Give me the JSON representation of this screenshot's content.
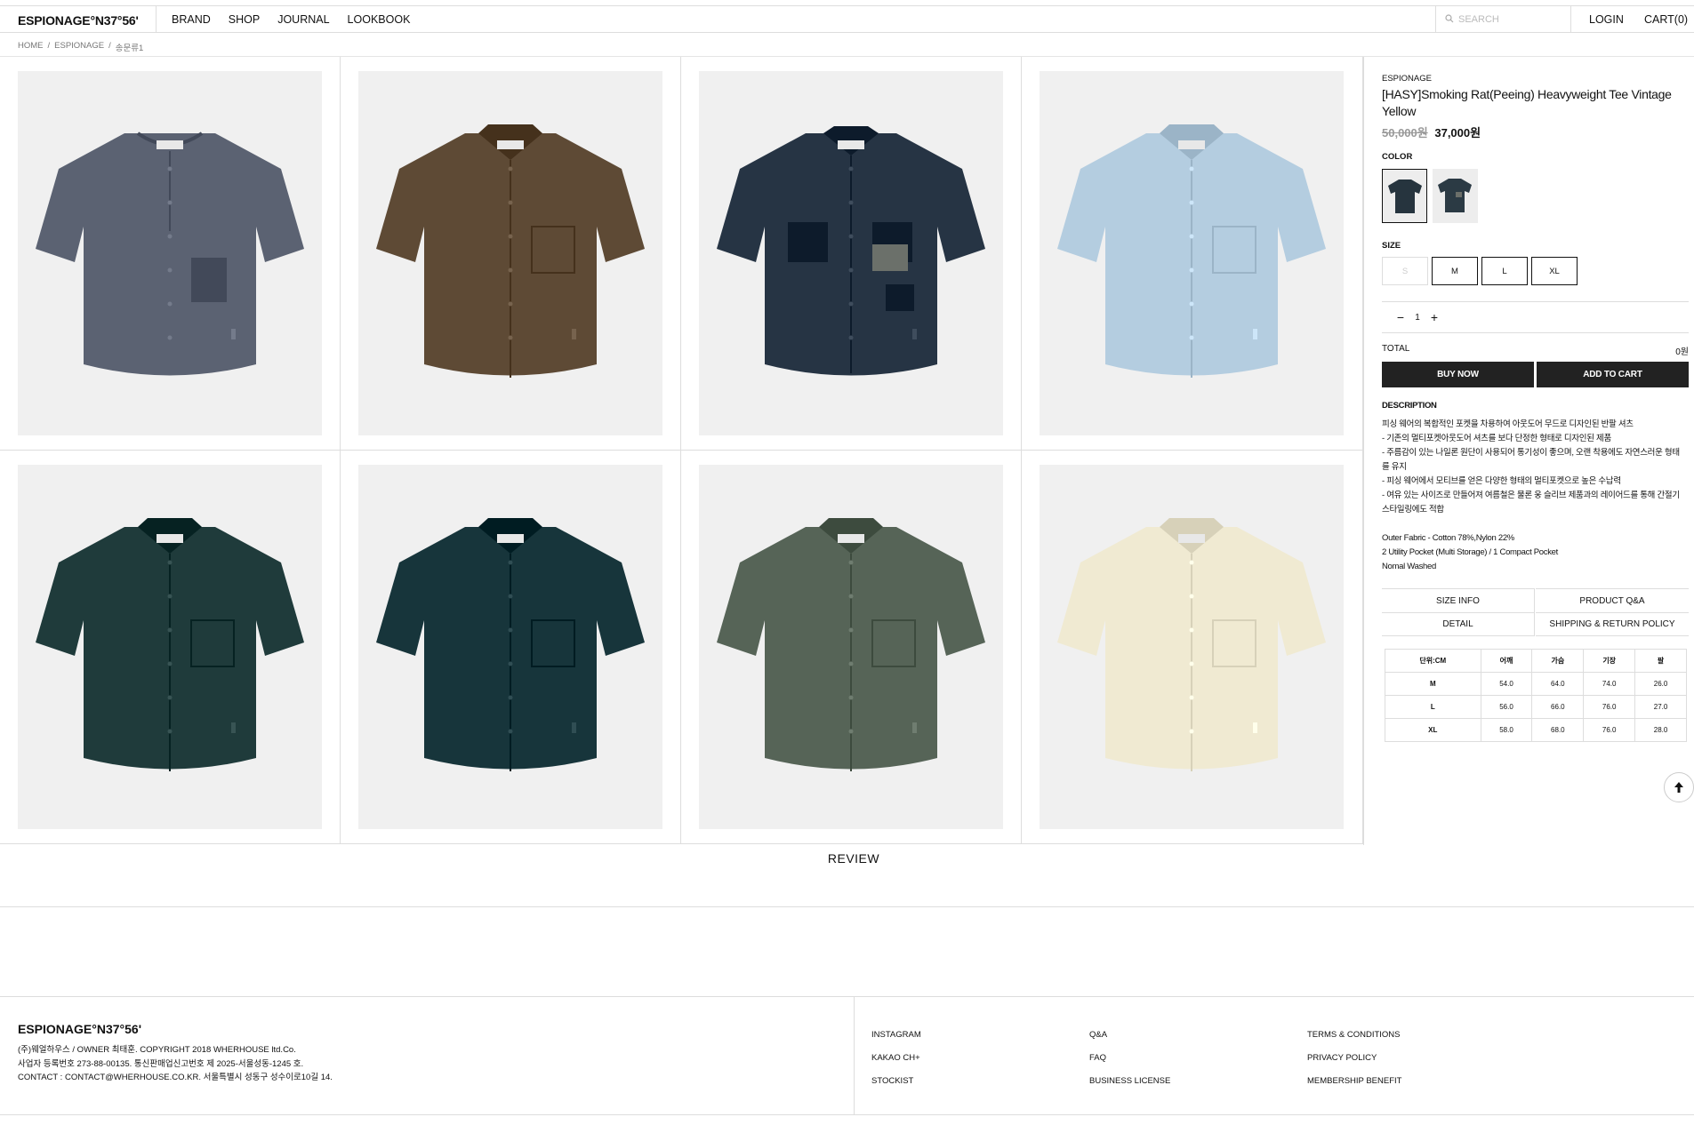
{
  "header": {
    "logo": "ESPIONAGE°N37°56'",
    "nav": [
      "BRAND",
      "SHOP",
      "JOURNAL",
      "LOOKBOOK"
    ],
    "search_placeholder": "SEARCH",
    "login": "LOGIN",
    "cart": "CART(0)"
  },
  "breadcrumb": [
    "HOME",
    "/",
    "ESPIONAGE",
    "/",
    "송문류1"
  ],
  "gallery": [
    {
      "color": "#5b6272",
      "style": "henley"
    },
    {
      "color": "#5e4a35",
      "style": "shirt"
    },
    {
      "color": "#263444",
      "style": "utility"
    },
    {
      "color": "#b4cde0",
      "style": "open"
    },
    {
      "color": "#1f3b3b",
      "style": "open"
    },
    {
      "color": "#17353b",
      "style": "shirt"
    },
    {
      "color": "#566457",
      "style": "open"
    },
    {
      "color": "#f0ead2",
      "style": "shirt"
    }
  ],
  "product": {
    "brand": "ESPIONAGE",
    "title": "[HASY]Smoking Rat(Peeing) Heavyweight Tee Vintage Yellow",
    "price_original": "50,000원",
    "price_sale": "37,000원",
    "color_label": "COLOR",
    "swatches": [
      "#26343e",
      "#2b3a44"
    ],
    "size_label": "SIZE",
    "sizes": [
      "S",
      "M",
      "L",
      "XL"
    ],
    "quantity": "1",
    "total_label": "TOTAL",
    "total_value": "0원",
    "buy_now": "BUY NOW",
    "add_to_cart": "ADD TO CART",
    "description_label": "DESCRIPTION",
    "description": [
      "피싱 웨어의 복합적인 포켓을 차용하여 아웃도어 무드로 디자인된 반팔 셔츠",
      "- 기존의 멀티포켓아웃도어 셔츠를 보다 단정한 형태로 디자인된 제품",
      "- 주름감이 있는 나일론 원단이 사용되어 통기성이 좋으며, 오랜 착용에도 자연스러운 형태",
      "를 유지",
      "- 피싱 웨어에서 모티브를 얻은 다양한 형태의 멀티포켓으로 높은 수납력",
      "- 여유 있는 사이즈로 만들어져 여름철은 물론 웅 슬리브 제품과의 레이어드를 통해 간절기",
      "스타일링에도 적합"
    ],
    "specs": [
      "Outer Fabric - Cotton 78%,Nylon 22%",
      "2 Utility Pocket (Multi Storage) / 1 Compact Pocket",
      "Nomal Washed"
    ],
    "tabs": [
      "SIZE INFO",
      "PRODUCT Q&A",
      "DETAIL",
      "SHIPPING & RETURN POLICY"
    ],
    "size_table": {
      "headers": [
        "단위:CM",
        "어깨",
        "가슴",
        "기장",
        "팔"
      ],
      "rows": [
        [
          "M",
          "54.0",
          "64.0",
          "74.0",
          "26.0"
        ],
        [
          "L",
          "56.0",
          "66.0",
          "76.0",
          "27.0"
        ],
        [
          "XL",
          "58.0",
          "68.0",
          "76.0",
          "28.0"
        ]
      ]
    }
  },
  "review": "REVIEW",
  "footer": {
    "logo": "ESPIONAGE°N37°56'",
    "info": [
      "(주)웨얼하우스 / OWNER 최태훈. COPYRIGHT 2018 WHERHOUSE ltd.Co.",
      "사업자 등록번호 273-88-00135. 통신판매업신고번호 제 2025-서울성동-1245 호.",
      "CONTACT : CONTACT@WHERHOUSE.CO.KR. 서울특별시 성동구 성수이로10길 14."
    ],
    "col1": [
      "INSTAGRAM",
      "KAKAO CH+",
      "STOCKIST"
    ],
    "col2": [
      "Q&A",
      "FAQ",
      "BUSINESS LICENSE"
    ],
    "col3": [
      "TERMS & CONDITIONS",
      "PRIVACY POLICY",
      "MEMBERSHIP BENEFIT"
    ]
  }
}
